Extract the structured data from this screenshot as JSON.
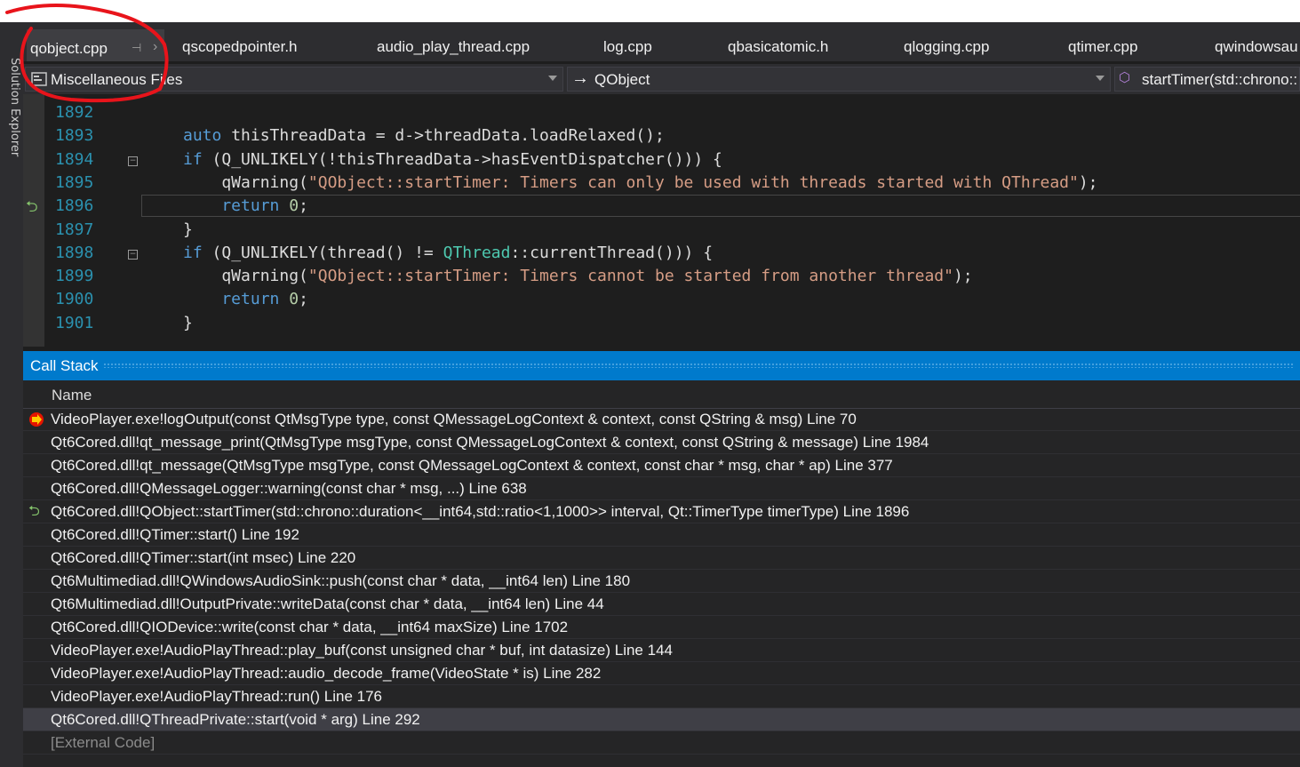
{
  "sidebar": {
    "label": "Solution Explorer"
  },
  "tabs": [
    {
      "label": "qobject.cpp",
      "active": true
    },
    {
      "label": "qscopedpointer.h"
    },
    {
      "label": "audio_play_thread.cpp"
    },
    {
      "label": "log.cpp"
    },
    {
      "label": "qbasicatomic.h"
    },
    {
      "label": "qlogging.cpp"
    },
    {
      "label": "qtimer.cpp"
    },
    {
      "label": "qwindowsau"
    }
  ],
  "navbar": {
    "project": "Miscellaneous Files",
    "scope": "QObject",
    "member": "startTimer(std::chrono::"
  },
  "code_lines": [
    {
      "number": "1892",
      "tokens": [
        {
          "t": "",
          "c": "id"
        }
      ]
    },
    {
      "number": "1893",
      "tokens": [
        {
          "t": "auto ",
          "c": "kw"
        },
        {
          "t": "thisThreadData = d->threadData.loadRelaxed();",
          "c": "id"
        }
      ]
    },
    {
      "number": "1894",
      "tokens": [
        {
          "t": "if ",
          "c": "kw"
        },
        {
          "t": "(Q_UNLIKELY(!thisThreadData->hasEventDispatcher())) {",
          "c": "id"
        }
      ]
    },
    {
      "number": "1895",
      "tokens": [
        {
          "t": "    qWarning(",
          "c": "id"
        },
        {
          "t": "\"QObject::startTimer: Timers can only be used with threads started with QThread\"",
          "c": "str"
        },
        {
          "t": ");",
          "c": "id"
        }
      ]
    },
    {
      "number": "1896",
      "tokens": [
        {
          "t": "    return ",
          "c": "kw"
        },
        {
          "t": "0",
          "c": "num"
        },
        {
          "t": ";",
          "c": "id"
        }
      ]
    },
    {
      "number": "1897",
      "tokens": [
        {
          "t": "}",
          "c": "id"
        }
      ]
    },
    {
      "number": "1898",
      "tokens": [
        {
          "t": "if ",
          "c": "kw"
        },
        {
          "t": "(Q_UNLIKELY(thread() != ",
          "c": "id"
        },
        {
          "t": "QThread",
          "c": "typ"
        },
        {
          "t": "::currentThread())) {",
          "c": "id"
        }
      ]
    },
    {
      "number": "1899",
      "tokens": [
        {
          "t": "    qWarning(",
          "c": "id"
        },
        {
          "t": "\"QObject::startTimer: Timers cannot be started from another thread\"",
          "c": "str"
        },
        {
          "t": ");",
          "c": "id"
        }
      ]
    },
    {
      "number": "1900",
      "tokens": [
        {
          "t": "    return ",
          "c": "kw"
        },
        {
          "t": "0",
          "c": "num"
        },
        {
          "t": ";",
          "c": "id"
        }
      ]
    },
    {
      "number": "1901",
      "tokens": [
        {
          "t": "}",
          "c": "id"
        }
      ]
    }
  ],
  "call_stack": {
    "title": "Call Stack",
    "column_name": "Name",
    "rows": [
      {
        "text": "VideoPlayer.exe!logOutput(const QtMsgType type, const QMessageLogContext & context, const QString & msg) Line 70",
        "icon": "breakpoint-current-icon"
      },
      {
        "text": "Qt6Cored.dll!qt_message_print(QtMsgType msgType, const QMessageLogContext & context, const QString & message) Line 1984"
      },
      {
        "text": "Qt6Cored.dll!qt_message(QtMsgType msgType, const QMessageLogContext & context, const char * msg, char * ap) Line 377"
      },
      {
        "text": "Qt6Cored.dll!QMessageLogger::warning(const char * msg, ...) Line 638"
      },
      {
        "text": "Qt6Cored.dll!QObject::startTimer(std::chrono::duration<__int64,std::ratio<1,1000>> interval, Qt::TimerType timerType) Line 1896",
        "icon": "call-return-arrow-icon"
      },
      {
        "text": "Qt6Cored.dll!QTimer::start() Line 192"
      },
      {
        "text": "Qt6Cored.dll!QTimer::start(int msec) Line 220"
      },
      {
        "text": "Qt6Multimediad.dll!QWindowsAudioSink::push(const char * data, __int64 len) Line 180"
      },
      {
        "text": "Qt6Multimediad.dll!OutputPrivate::writeData(const char * data, __int64 len) Line 44"
      },
      {
        "text": "Qt6Cored.dll!QIODevice::write(const char * data, __int64 maxSize) Line 1702"
      },
      {
        "text": "VideoPlayer.exe!AudioPlayThread::play_buf(const unsigned char * buf, int datasize) Line 144"
      },
      {
        "text": "VideoPlayer.exe!AudioPlayThread::audio_decode_frame(VideoState * is) Line 282"
      },
      {
        "text": "VideoPlayer.exe!AudioPlayThread::run() Line 176"
      },
      {
        "text": "Qt6Cored.dll!QThreadPrivate::start(void * arg) Line 292",
        "selected": true
      },
      {
        "text": "[External Code]",
        "external": true
      }
    ]
  },
  "colors": {
    "accent": "#007acc",
    "annotation_circle": "#e8141b",
    "keyword": "#569cd6",
    "string": "#d69d85",
    "line_number": "#2b91af"
  }
}
